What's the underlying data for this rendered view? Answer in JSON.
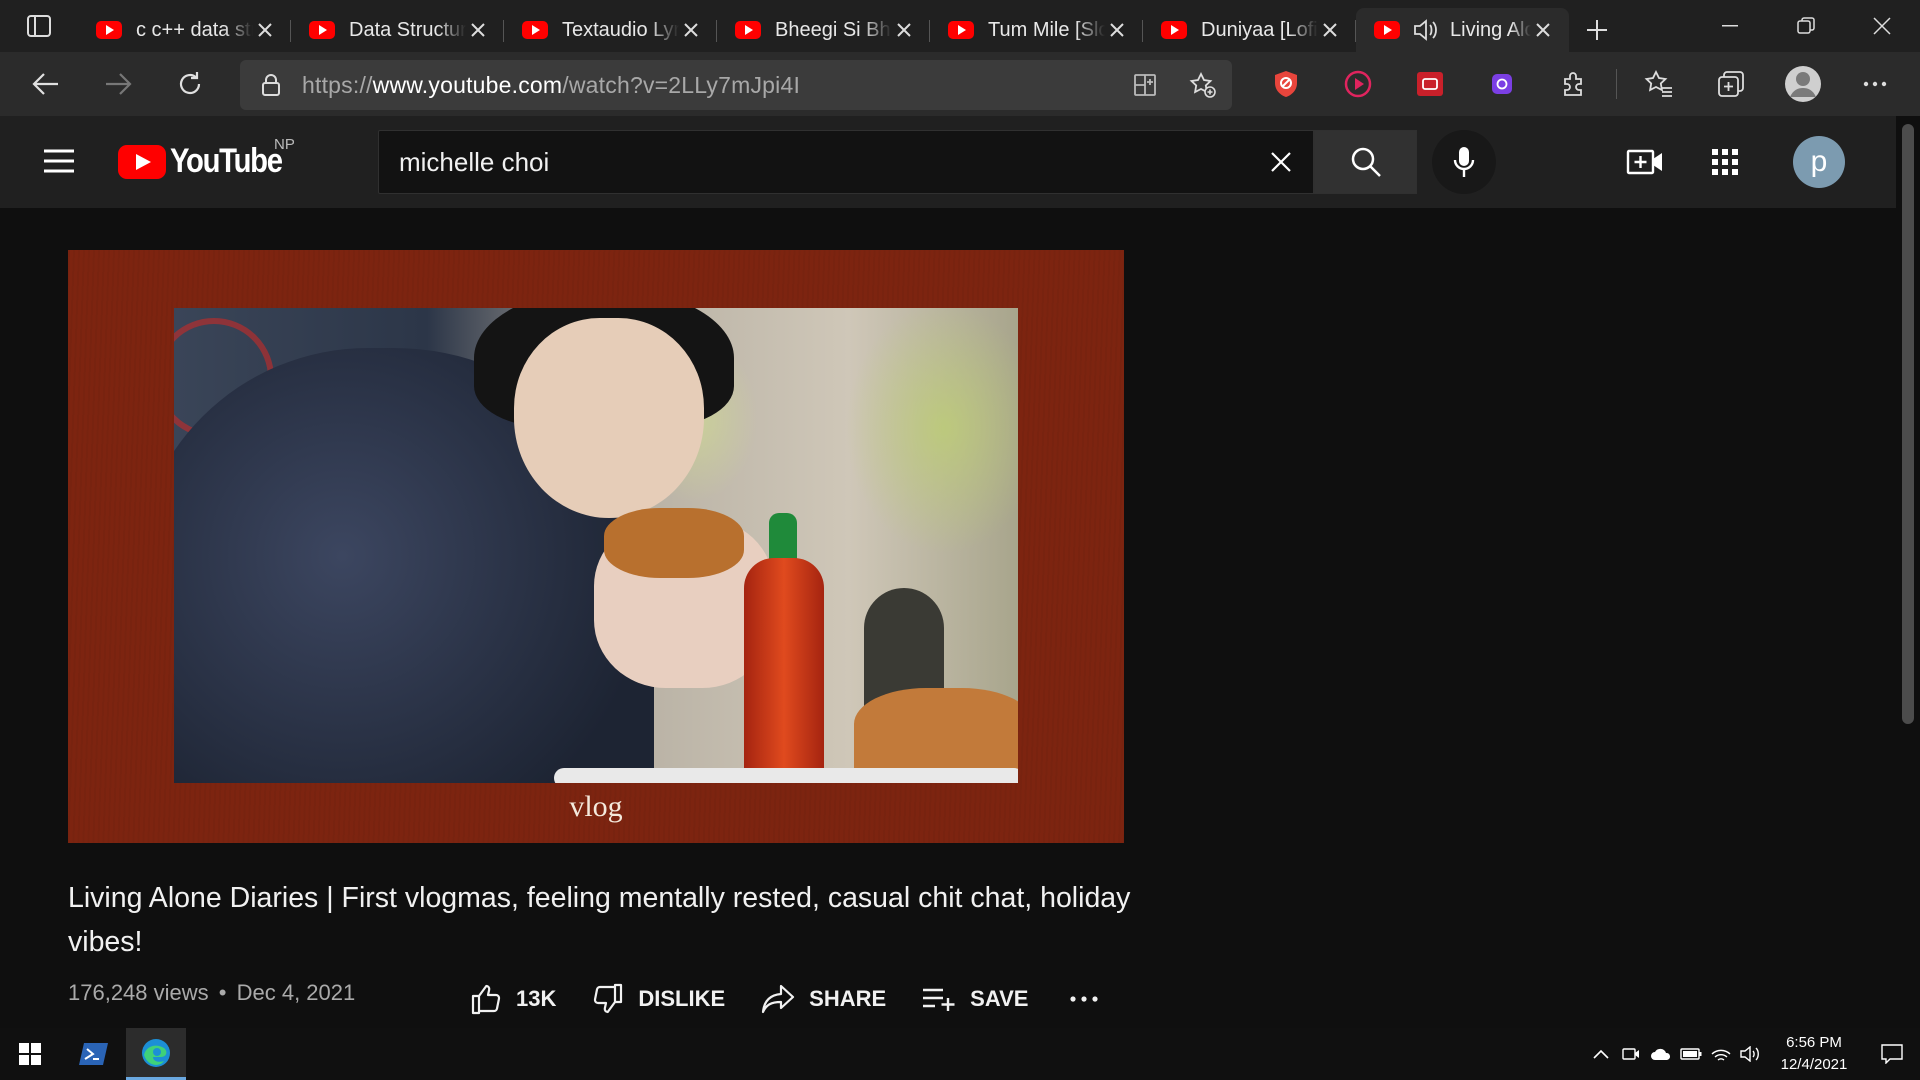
{
  "browser": {
    "tabs": [
      {
        "title": "c c++ data structures"
      },
      {
        "title": "Data Structures"
      },
      {
        "title": "Textaudio Lyrics"
      },
      {
        "title": "Bheegi Si Bhaagi"
      },
      {
        "title": "Tum Mile [Slowed]"
      },
      {
        "title": "Duniyaa [Lofi]"
      },
      {
        "title": "Living Alone Diaries",
        "active": true,
        "audio": true
      }
    ],
    "address": {
      "prefix": "https://",
      "domain": "www.youtube.com",
      "path": "/watch?v=2LLy7mJpi4I"
    }
  },
  "youtube": {
    "logo_text": "YouTube",
    "country_code": "NP",
    "search": {
      "query": "michelle choi"
    },
    "avatar_letter": "p"
  },
  "video": {
    "caption": "vlog",
    "title": "Living Alone Diaries | First vlogmas, feeling mentally rested, casual chit chat, holiday vibes!",
    "views": "176,248 views",
    "separator": "•",
    "date": "Dec 4, 2021",
    "likes": "13K",
    "dislike_label": "DISLIKE",
    "share_label": "SHARE",
    "save_label": "SAVE"
  },
  "taskbar": {
    "time": "6:56 PM",
    "date": "12/4/2021"
  },
  "colors": {
    "youtube_red": "#ff0000",
    "frame_border": "#7d2410",
    "background": "#0f0f0f"
  }
}
